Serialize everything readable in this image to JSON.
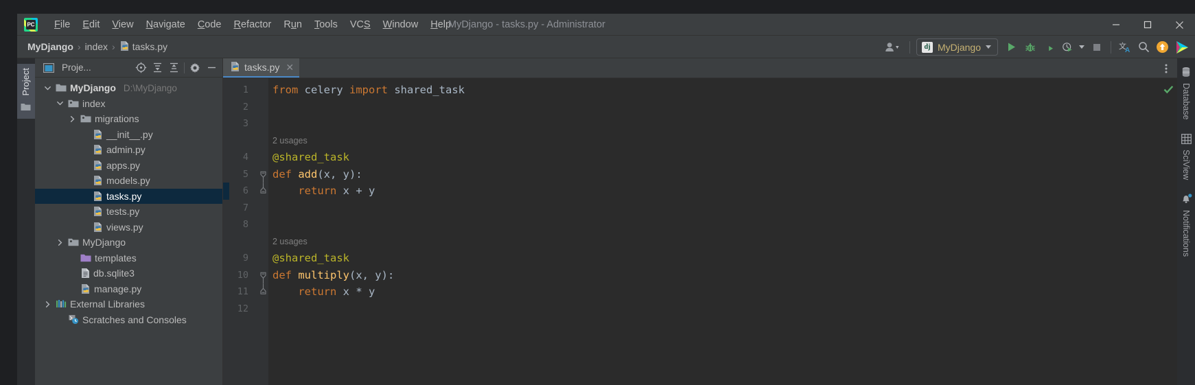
{
  "window": {
    "title": "MyDjango - tasks.py - Administrator",
    "app_icon": "pycharm-logo-icon",
    "minimize_label": "–",
    "maximize_label": "□",
    "close_label": "✕"
  },
  "menubar": {
    "items": [
      {
        "label": "File",
        "mnemonic": "F"
      },
      {
        "label": "Edit",
        "mnemonic": "E"
      },
      {
        "label": "View",
        "mnemonic": "V"
      },
      {
        "label": "Navigate",
        "mnemonic": "N"
      },
      {
        "label": "Code",
        "mnemonic": "C"
      },
      {
        "label": "Refactor",
        "mnemonic": "R"
      },
      {
        "label": "Run",
        "mnemonic": "u"
      },
      {
        "label": "Tools",
        "mnemonic": "T"
      },
      {
        "label": "VCS",
        "mnemonic": "S"
      },
      {
        "label": "Window",
        "mnemonic": "W"
      },
      {
        "label": "Help",
        "mnemonic": "H"
      }
    ]
  },
  "breadcrumb": {
    "separator": "›",
    "items": [
      {
        "label": "MyDjango",
        "bold": true,
        "icon": null
      },
      {
        "label": "index",
        "bold": false,
        "icon": null
      },
      {
        "label": "tasks.py",
        "bold": false,
        "icon": "python-file-icon"
      }
    ]
  },
  "toolbar": {
    "account_icon": "user-account-icon",
    "run_config": {
      "icon": "django-icon",
      "icon_text": "dj",
      "label": "MyDjango",
      "dropdown_icon": "chevron-down-icon"
    },
    "run_button": "run-icon",
    "debug_button": "debug-bug-icon",
    "run_coverage_button": "run-with-coverage-icon",
    "profile_button": "profiler-icon",
    "profile_dropdown": "chevron-down-icon",
    "stop_button": "stop-icon",
    "translate_button": "translate-icon",
    "translate_glyph": "文",
    "translate_sub": "A",
    "search_button": "search-icon",
    "update_button": "update-arrow-icon",
    "ide_feature_button": "ide-colorful-play-icon"
  },
  "left_stripe": {
    "project_tab": "Project",
    "folder_icon": "folder-icon"
  },
  "project_panel": {
    "header": {
      "panel_icon": "project-window-icon",
      "title": "Proje...",
      "locate_icon": "select-opened-file-icon",
      "expand_icon": "expand-all-icon",
      "collapse_icon": "collapse-all-icon",
      "settings_icon": "gear-icon",
      "hide_icon": "minimize-icon"
    },
    "tree": [
      {
        "label": "MyDjango",
        "path": "D:\\MyDjango",
        "icon": "folder-icon",
        "arrow": "expanded",
        "indent": 0,
        "bold": true,
        "selected": false
      },
      {
        "label": "index",
        "path": "",
        "icon": "module-folder-icon",
        "arrow": "expanded",
        "indent": 1,
        "bold": false,
        "selected": false
      },
      {
        "label": "migrations",
        "path": "",
        "icon": "module-folder-icon",
        "arrow": "collapsed",
        "indent": 2,
        "bold": false,
        "selected": false
      },
      {
        "label": "__init__.py",
        "path": "",
        "icon": "python-file-icon",
        "arrow": "none",
        "indent": 3,
        "bold": false,
        "selected": false
      },
      {
        "label": "admin.py",
        "path": "",
        "icon": "python-file-icon",
        "arrow": "none",
        "indent": 3,
        "bold": false,
        "selected": false
      },
      {
        "label": "apps.py",
        "path": "",
        "icon": "python-file-icon",
        "arrow": "none",
        "indent": 3,
        "bold": false,
        "selected": false
      },
      {
        "label": "models.py",
        "path": "",
        "icon": "python-file-icon",
        "arrow": "none",
        "indent": 3,
        "bold": false,
        "selected": false
      },
      {
        "label": "tasks.py",
        "path": "",
        "icon": "python-file-icon",
        "arrow": "none",
        "indent": 3,
        "bold": false,
        "selected": true
      },
      {
        "label": "tests.py",
        "path": "",
        "icon": "python-file-icon",
        "arrow": "none",
        "indent": 3,
        "bold": false,
        "selected": false
      },
      {
        "label": "views.py",
        "path": "",
        "icon": "python-file-icon",
        "arrow": "none",
        "indent": 3,
        "bold": false,
        "selected": false
      },
      {
        "label": "MyDjango",
        "path": "",
        "icon": "module-folder-icon",
        "arrow": "collapsed",
        "indent": 1,
        "bold": false,
        "selected": false
      },
      {
        "label": "templates",
        "path": "",
        "icon": "templates-folder-icon",
        "arrow": "none",
        "indent": 2,
        "bold": false,
        "selected": false
      },
      {
        "label": "db.sqlite3",
        "path": "",
        "icon": "database-file-icon",
        "arrow": "none",
        "indent": 2,
        "bold": false,
        "selected": false
      },
      {
        "label": "manage.py",
        "path": "",
        "icon": "python-file-icon",
        "arrow": "none",
        "indent": 2,
        "bold": false,
        "selected": false
      },
      {
        "label": "External Libraries",
        "path": "",
        "icon": "libraries-icon",
        "arrow": "collapsed",
        "indent": 0,
        "bold": false,
        "selected": false
      },
      {
        "label": "Scratches and Consoles",
        "path": "",
        "icon": "scratches-icon",
        "arrow": "none",
        "indent": 1,
        "bold": false,
        "selected": false
      }
    ]
  },
  "editor": {
    "tab": {
      "label": "tasks.py",
      "icon": "python-file-icon",
      "close_icon": "close-icon"
    },
    "more_icon": "vertical-dots-icon",
    "inspection_status": "no-problems-checkmark",
    "file_name": "tasks.py",
    "lines": [
      {
        "number": "1",
        "indent": 0,
        "tokens": [
          {
            "t": "from ",
            "c": "kw"
          },
          {
            "t": "celery ",
            "c": "id"
          },
          {
            "t": "import ",
            "c": "kw"
          },
          {
            "t": "shared_task",
            "c": "id"
          }
        ],
        "fold": null
      },
      {
        "number": "2",
        "indent": 0,
        "tokens": [],
        "fold": null
      },
      {
        "number": "3",
        "indent": 0,
        "tokens": [],
        "fold": null
      },
      {
        "number": "4",
        "indent": 0,
        "tokens": [
          {
            "t": "@shared_task",
            "c": "dec"
          }
        ],
        "fold": null
      },
      {
        "number": "5",
        "indent": 0,
        "tokens": [
          {
            "t": "def ",
            "c": "kw"
          },
          {
            "t": "add",
            "c": "fn"
          },
          {
            "t": "(x, y):",
            "c": "id"
          }
        ],
        "fold": "start"
      },
      {
        "number": "6",
        "indent": 0,
        "tokens": [
          {
            "t": "    ",
            "c": "id"
          },
          {
            "t": "return ",
            "c": "kw"
          },
          {
            "t": "x + y",
            "c": "id"
          }
        ],
        "fold": "end"
      },
      {
        "number": "7",
        "indent": 0,
        "tokens": [],
        "fold": null
      },
      {
        "number": "8",
        "indent": 0,
        "tokens": [],
        "fold": null
      },
      {
        "number": "9",
        "indent": 0,
        "tokens": [
          {
            "t": "@shared_task",
            "c": "dec"
          }
        ],
        "fold": null
      },
      {
        "number": "10",
        "indent": 0,
        "tokens": [
          {
            "t": "def ",
            "c": "kw"
          },
          {
            "t": "multiply",
            "c": "fn"
          },
          {
            "t": "(x, y):",
            "c": "id"
          }
        ],
        "fold": "start"
      },
      {
        "number": "11",
        "indent": 0,
        "tokens": [
          {
            "t": "    ",
            "c": "id"
          },
          {
            "t": "return ",
            "c": "kw"
          },
          {
            "t": "x * y",
            "c": "id"
          }
        ],
        "fold": "end"
      },
      {
        "number": "12",
        "indent": 0,
        "tokens": [],
        "fold": null
      }
    ],
    "code_vision": [
      {
        "text": "2 usages",
        "above_line": "4"
      },
      {
        "text": "2 usages",
        "above_line": "9"
      }
    ]
  },
  "right_stripe": {
    "items": [
      {
        "label": "Database",
        "icon": "database-icon",
        "badge": false
      },
      {
        "label": "SciView",
        "icon": "sciview-grid-icon",
        "badge": false
      },
      {
        "label": "Notifications",
        "icon": "bell-icon",
        "badge": true
      }
    ]
  },
  "colors": {
    "background": "#2b2b2b",
    "panel": "#3c3f41",
    "stripe": "#2b2d30",
    "selection": "#0d293e",
    "accent_blue": "#4a88c7",
    "keyword_orange": "#cc7832",
    "function_yellow": "#ffc66d",
    "decorator_yellow": "#bbb529",
    "identifier": "#a9b7c6",
    "run_green": "#59a869",
    "hint_gray": "#808080",
    "config_text": "#c7b273"
  }
}
